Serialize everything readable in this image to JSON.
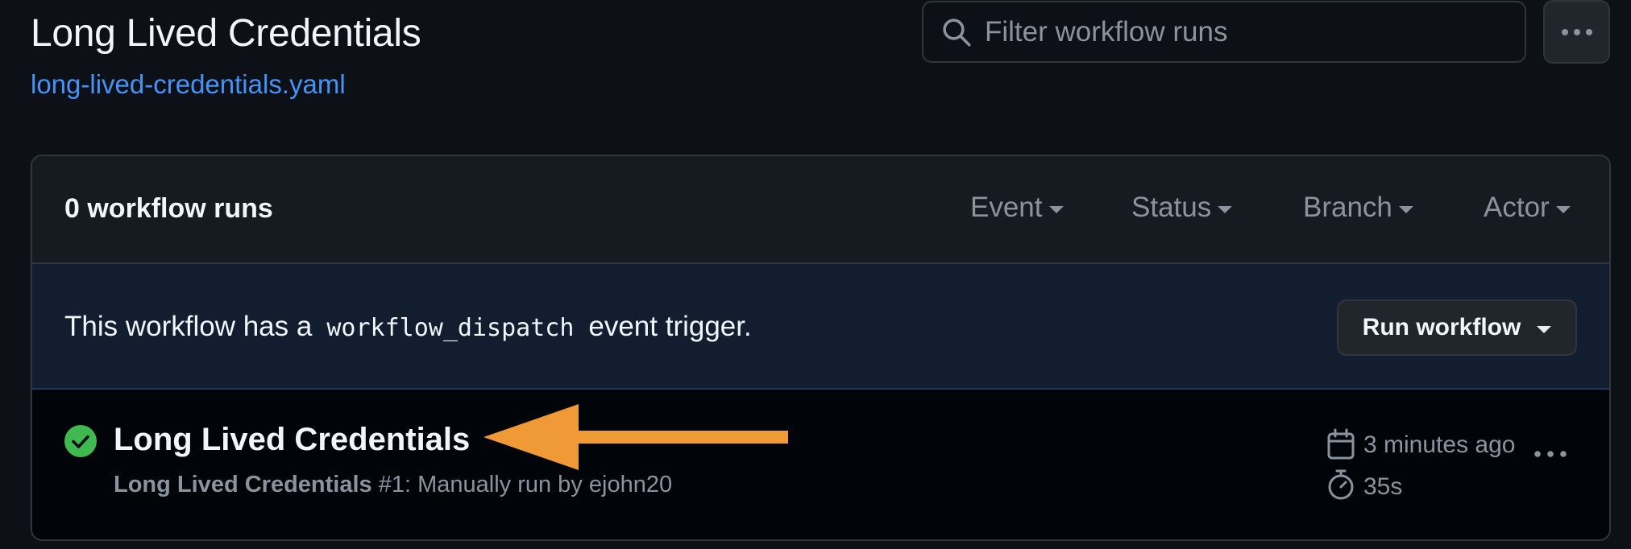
{
  "workflow": {
    "title": "Long Lived Credentials",
    "file_link": "long-lived-credentials.yaml"
  },
  "search": {
    "placeholder": "Filter workflow runs",
    "value": ""
  },
  "runs_header": {
    "count_label": "0 workflow runs",
    "filters": [
      "Event",
      "Status",
      "Branch",
      "Actor"
    ]
  },
  "dispatch": {
    "text_before": "This workflow has a",
    "code": "workflow_dispatch",
    "text_after": "event trigger.",
    "button_label": "Run workflow"
  },
  "run": {
    "title": "Long Lived Credentials",
    "workflow_name": "Long Lived Credentials",
    "meta_rest": " #1: Manually run by ejohn20",
    "time_ago": "3 minutes ago",
    "duration": "35s",
    "status": "success"
  },
  "colors": {
    "success": "#3fb950",
    "link": "#4493f8",
    "annotation_arrow": "#f09a37"
  },
  "icons": {
    "search": "search-icon",
    "kebab": "kebab-horizontal-icon",
    "status": "check-circle-fill-icon",
    "calendar": "calendar-icon",
    "stopwatch": "stopwatch-icon",
    "annotation": "arrow-left-icon"
  }
}
